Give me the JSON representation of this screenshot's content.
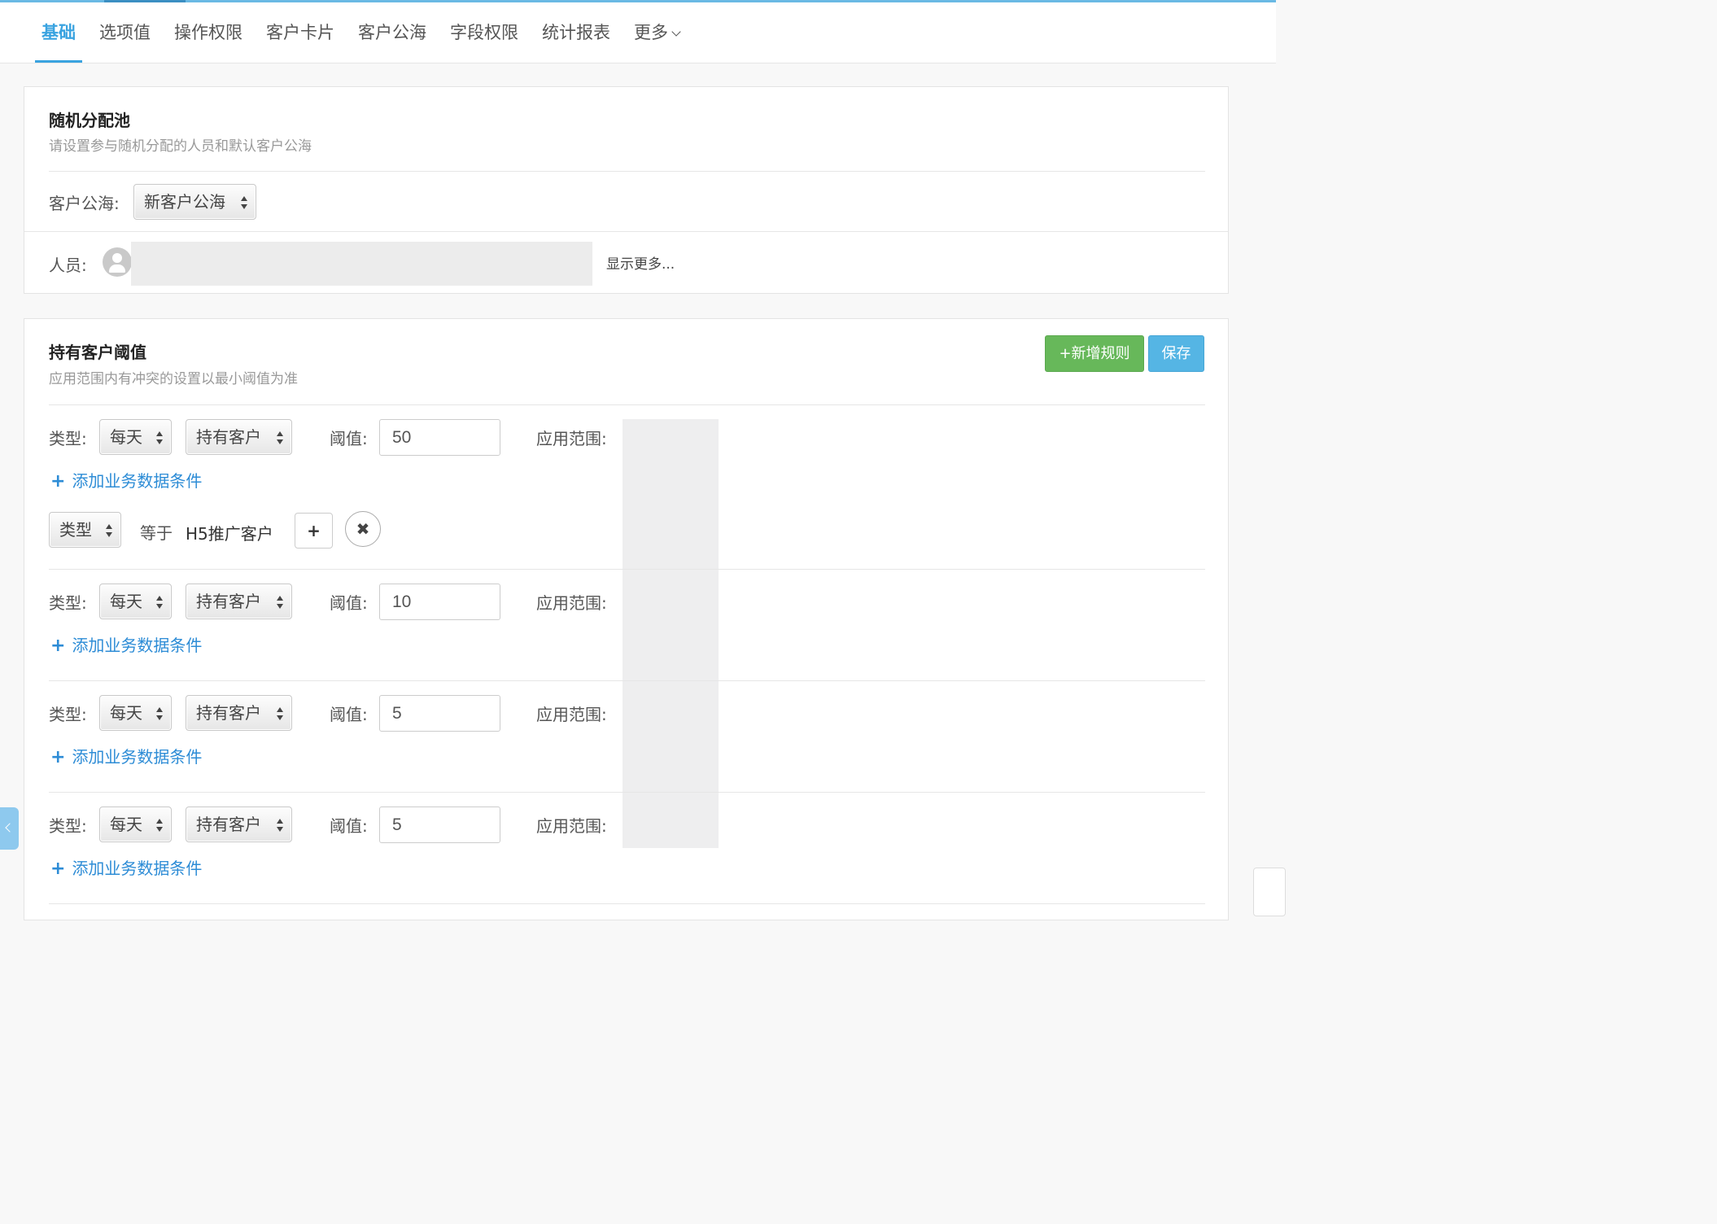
{
  "tabs": [
    {
      "label": "基础",
      "active": true
    },
    {
      "label": "选项值"
    },
    {
      "label": "操作权限"
    },
    {
      "label": "客户卡片"
    },
    {
      "label": "客户公海"
    },
    {
      "label": "字段权限"
    },
    {
      "label": "统计报表"
    },
    {
      "label": "更多"
    }
  ],
  "pool": {
    "title": "随机分配池",
    "subtitle": "请设置参与随机分配的人员和默认客户公海",
    "sea_label": "客户公海:",
    "sea_value": "新客户公海",
    "people_label": "人员:",
    "show_more": "显示更多..."
  },
  "threshold": {
    "title": "持有客户阈值",
    "subtitle": "应用范围内有冲突的设置以最小阈值为准",
    "add_rule_label": "+新增规则",
    "save_label": "保存",
    "type_label": "类型:",
    "threshold_label": "阈值:",
    "scope_label": "应用范围:",
    "add_condition_label": "添加业务数据条件",
    "rules": [
      {
        "period": "每天",
        "kind": "持有客户",
        "value": "50",
        "condition": {
          "field": "类型",
          "op": "等于",
          "value": "H5推广客户"
        }
      },
      {
        "period": "每天",
        "kind": "持有客户",
        "value": "10"
      },
      {
        "period": "每天",
        "kind": "持有客户",
        "value": "5"
      },
      {
        "period": "每天",
        "kind": "持有客户",
        "value": "5"
      }
    ]
  },
  "icons": {
    "plus": "+",
    "close": "✖"
  },
  "colors": {
    "accent": "#3aa3e0",
    "green_button": "#67b85a",
    "blue_button": "#55b5e4",
    "link": "#2d8cd6"
  }
}
